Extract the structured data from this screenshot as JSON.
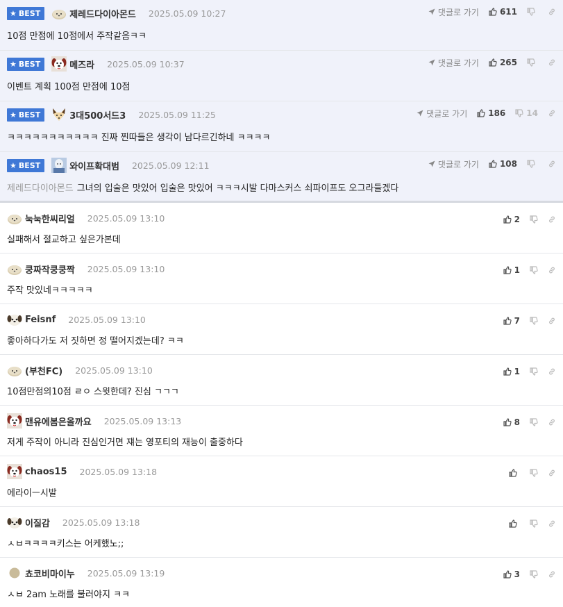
{
  "ui": {
    "best_label": "BEST",
    "reply_label": "댓글로 가기"
  },
  "best_comments": [
    {
      "nick": "제레드다이아몬드",
      "date": "2025.05.09 10:27",
      "likes": "611",
      "dislikes": "",
      "ref": "",
      "text": "10점 만점에 10점에서 주작같음ㅋㅋ",
      "avatar": "blob-avatar"
    },
    {
      "nick": "메즈라",
      "date": "2025.05.09 10:37",
      "likes": "265",
      "dislikes": "",
      "ref": "",
      "text": "이벤트 계획 100점 만점에 10점",
      "avatar": "dog-face-avatar"
    },
    {
      "nick": "3대500서드3",
      "date": "2025.05.09 11:25",
      "likes": "186",
      "dislikes": "14",
      "ref": "",
      "text": "ㅋㅋㅋㅋㅋㅋㅋㅋㅋㅋㅋ 진짜 찐따들은 생각이 남다르긴하네 ㅋㅋㅋㅋ",
      "avatar": "fox-avatar"
    },
    {
      "nick": "와이프확대범",
      "date": "2025.05.09 12:11",
      "likes": "108",
      "dislikes": "",
      "ref": "제레드다이아몬드",
      "text": "그녀의 입술은 맛있어 입술은 맛있어 ㅋㅋㅋ시발 다마스커스 쇠파이프도 오그라들겠다",
      "avatar": "photo-avatar"
    }
  ],
  "comments": [
    {
      "nick": "눅눅한씨리얼",
      "date": "2025.05.09 13:10",
      "likes": "2",
      "text": "실패해서 절교하고 싶은가본데",
      "avatar": "blob-avatar"
    },
    {
      "nick": "쿵짜작쿵쿵짝",
      "date": "2025.05.09 13:10",
      "likes": "1",
      "text": "주작 맛있네ㅋㅋㅋㅋㅋ",
      "avatar": "blob-avatar"
    },
    {
      "nick": "Feisnf",
      "date": "2025.05.09 13:10",
      "likes": "7",
      "text": "좋아하다가도 저 짓하면 정 떨어지겠는데? ㅋㅋ",
      "avatar": "puppy-avatar"
    },
    {
      "nick": "(부천FC)",
      "date": "2025.05.09 13:10",
      "likes": "1",
      "text": "10점만점의10점 ㄹㅇ 스윗한데? 진심 ㄱㄱㄱ",
      "avatar": "blob-avatar"
    },
    {
      "nick": "맨유에봄은올까요",
      "date": "2025.05.09 13:13",
      "likes": "8",
      "text": "저게 주작이 아니라 진심인거면 쟤는 영포티의 재능이 출중하다",
      "avatar": "dog-face-avatar"
    },
    {
      "nick": "chaos15",
      "date": "2025.05.09 13:18",
      "likes": "",
      "text": "에라이ㅡ시발",
      "avatar": "dog-face-avatar"
    },
    {
      "nick": "이질감",
      "date": "2025.05.09 13:18",
      "likes": "",
      "text": "ㅅㅂㅋㅋㅋㅋ키스는 어케했노;;",
      "avatar": "puppy-avatar"
    },
    {
      "nick": "쵸코비마이누",
      "date": "2025.05.09 13:19",
      "likes": "3",
      "text": "ㅅㅂ 2am 노래를 불러야지 ㅋㅋ",
      "avatar": "circle-avatar"
    }
  ]
}
